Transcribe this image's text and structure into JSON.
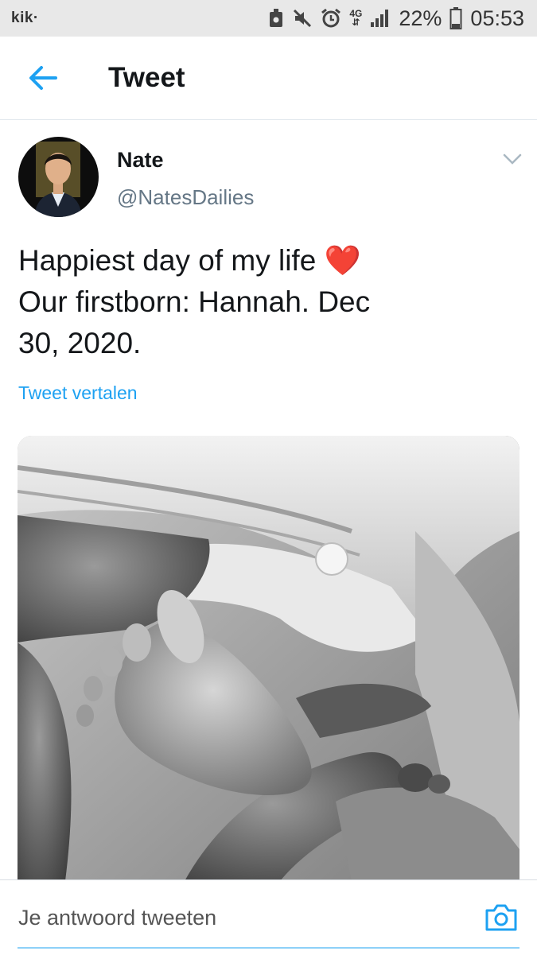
{
  "status_bar": {
    "app_label": "kik·",
    "network": "4G",
    "battery": "22%",
    "time": "05:53",
    "icons": [
      "screenshot-icon",
      "mute-icon",
      "alarm-icon",
      "signal-icon",
      "battery-icon"
    ]
  },
  "header": {
    "title": "Tweet",
    "back_icon": "arrow-left-icon"
  },
  "tweet": {
    "author_name": "Nate",
    "author_handle": "@NatesDailies",
    "text_line1": "Happiest day of my life ",
    "heart": "❤️",
    "text_line2": "Our firstborn: Hannah. Dec",
    "text_line3": "30, 2020.",
    "translate_label": "Tweet vertalen",
    "menu_icon": "chevron-down-icon",
    "media_icon": "photo"
  },
  "reply": {
    "placeholder": "Je antwoord tweeten",
    "camera_icon": "camera-icon"
  },
  "colors": {
    "accent": "#1da1f2",
    "text": "#14171a",
    "secondary": "#657786",
    "statusbar_bg": "#e8e8e8"
  }
}
